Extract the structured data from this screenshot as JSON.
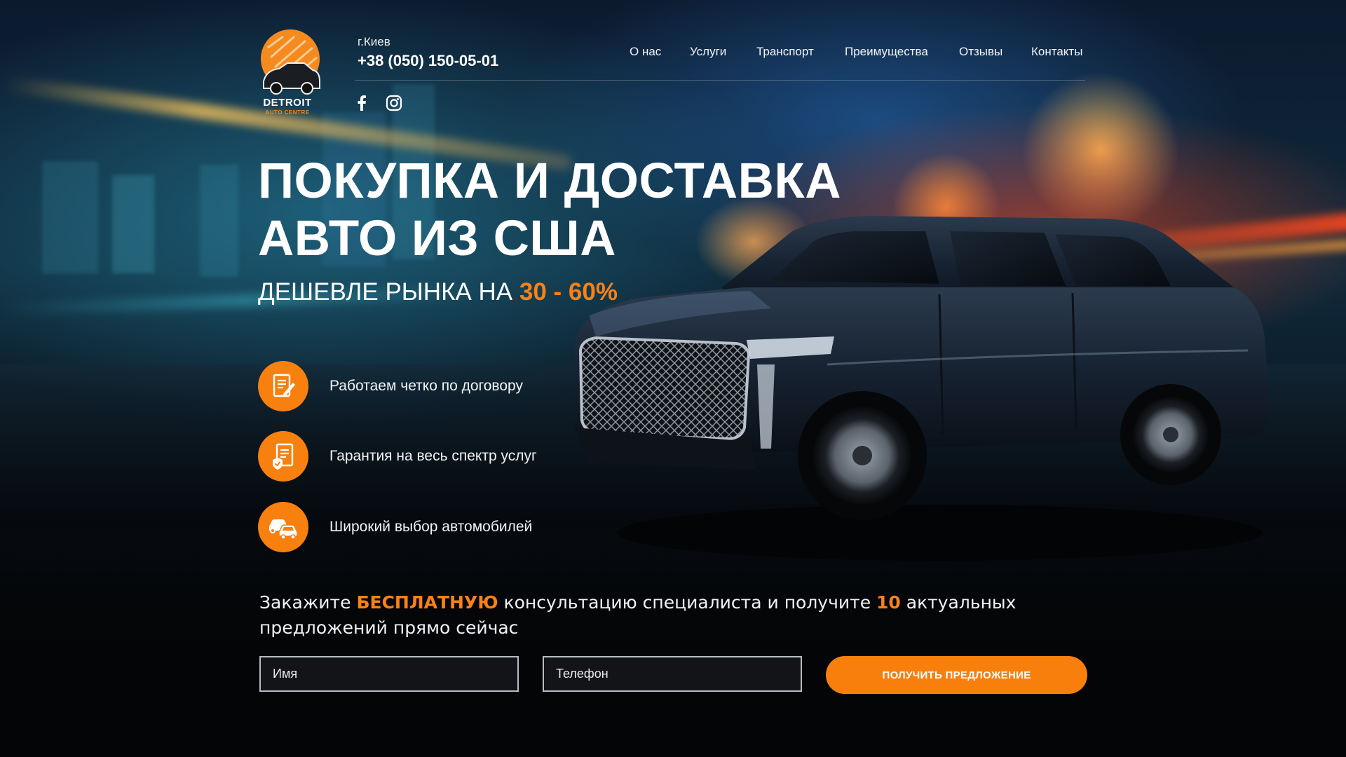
{
  "colors": {
    "accent": "#f98116",
    "button": "#f97f0d",
    "background": "#05070b"
  },
  "logo": {
    "title": "DETROIT",
    "subtitle": "AUTO CENTRE"
  },
  "header": {
    "city": "г.Киев",
    "phone": "+38 (050) 150-05-01",
    "social": [
      {
        "icon": "facebook-icon"
      },
      {
        "icon": "instagram-icon"
      }
    ],
    "nav": [
      "О нас",
      "Услуги",
      "Транспорт",
      "Преимущества",
      "Отзывы",
      "Контакты"
    ]
  },
  "hero": {
    "title_line1": "ПОКУПКА И ДОСТАВКА",
    "title_line2": "АВТО ИЗ США",
    "subtitle_prefix": "ДЕШЕВЛЕ РЫНКА НА ",
    "subtitle_accent": "30 - 60%"
  },
  "features": [
    {
      "icon": "contract-icon",
      "text": "Работаем четко по договору"
    },
    {
      "icon": "guarantee-icon",
      "text": "Гарантия на весь спектр услуг"
    },
    {
      "icon": "cars-icon",
      "text": "Широкий выбор автомобилей"
    }
  ],
  "offer": {
    "part1": "Закажите ",
    "highlight1": "БЕСПЛАТНУЮ",
    "part2": " консультацию специалиста и получите ",
    "highlight2": "10",
    "part3": " актуальных предложений прямо сейчас"
  },
  "form": {
    "name_placeholder": "Имя",
    "phone_placeholder": "Телефон",
    "submit_label": "ПОЛУЧИТЬ ПРЕДЛОЖЕНИЕ"
  }
}
